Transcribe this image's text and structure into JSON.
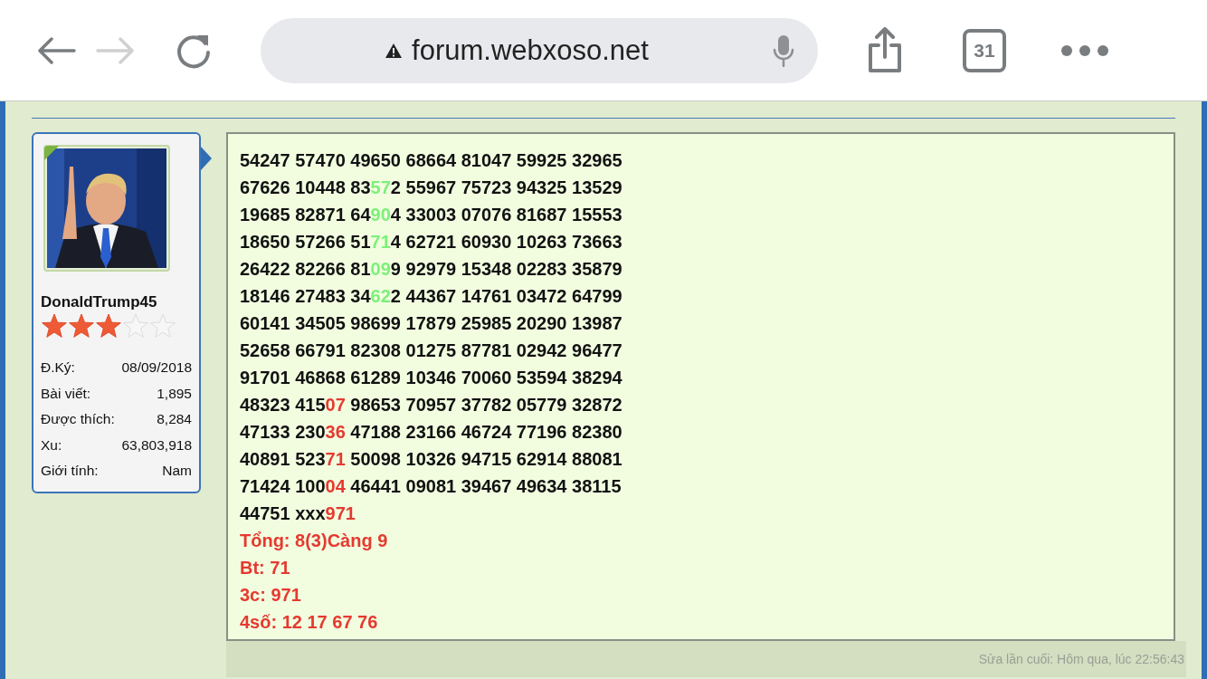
{
  "browser": {
    "url": "forum.webxoso.net",
    "tab_count": "31",
    "back_disabled": false,
    "forward_disabled": true
  },
  "user_card": {
    "username": "DonaldTrump45",
    "stars": 3,
    "stats": [
      {
        "label": "Đ.Ký:",
        "value": "08/09/2018"
      },
      {
        "label": "Bài viết:",
        "value": "1,895"
      },
      {
        "label": "Được thích:",
        "value": "8,284"
      },
      {
        "label": "Xu:",
        "value": "63,803,918"
      },
      {
        "label": "Giới tính:",
        "value": "Nam"
      }
    ]
  },
  "post": {
    "lines": [
      [
        {
          "text": "54247 57470 49650 68664 81047 59925 32965",
          "color": "#111111"
        }
      ],
      [
        {
          "text": "67626 10448 83",
          "color": "#111111"
        },
        {
          "text": "57",
          "color": "#7df07a"
        },
        {
          "text": "2 55967 75723 94325 13529",
          "color": "#111111"
        }
      ],
      [
        {
          "text": "19685 82871 64",
          "color": "#111111"
        },
        {
          "text": "90",
          "color": "#7df07a"
        },
        {
          "text": "4 33003 07076 81687 15553",
          "color": "#111111"
        }
      ],
      [
        {
          "text": "18650 57266 51",
          "color": "#111111"
        },
        {
          "text": "71",
          "color": "#7df07a"
        },
        {
          "text": "4 62721 60930 10263 73663",
          "color": "#111111"
        }
      ],
      [
        {
          "text": "26422 82266 81",
          "color": "#111111"
        },
        {
          "text": "09",
          "color": "#7df07a"
        },
        {
          "text": "9 92979 15348 02283 35879",
          "color": "#111111"
        }
      ],
      [
        {
          "text": "18146 27483 34",
          "color": "#111111"
        },
        {
          "text": "62",
          "color": "#7df07a"
        },
        {
          "text": "2 44367 14761 03472 64799",
          "color": "#111111"
        }
      ],
      [
        {
          "text": "60141 34505 98699 17879 25985 20290 13987",
          "color": "#111111"
        }
      ],
      [
        {
          "text": "52658 66791 82308 01275 87781 02942 96477",
          "color": "#111111"
        }
      ],
      [
        {
          "text": "91701 46868 61289 10346 70060 53594 38294",
          "color": "#111111"
        }
      ],
      [
        {
          "text": "48323 415",
          "color": "#111111"
        },
        {
          "text": "07",
          "color": "#e53a2f"
        },
        {
          "text": " 98653 70957 37782 05779 32872",
          "color": "#111111"
        }
      ],
      [
        {
          "text": "47133 230",
          "color": "#111111"
        },
        {
          "text": "36",
          "color": "#e53a2f"
        },
        {
          "text": " 47188 23166 46724 77196 82380",
          "color": "#111111"
        }
      ],
      [
        {
          "text": "40891 523",
          "color": "#111111"
        },
        {
          "text": "71",
          "color": "#e53a2f"
        },
        {
          "text": " 50098 10326 94715 62914 88081",
          "color": "#111111"
        }
      ],
      [
        {
          "text": "71424 100",
          "color": "#111111"
        },
        {
          "text": "04",
          "color": "#e53a2f"
        },
        {
          "text": " 46441 09081 39467 49634 38115",
          "color": "#111111"
        }
      ],
      [
        {
          "text": "44751 xxx",
          "color": "#111111"
        },
        {
          "text": "971",
          "color": "#e53a2f"
        }
      ],
      [
        {
          "text": "Tổng: 8(3)Càng 9",
          "color": "#e53a2f"
        }
      ],
      [
        {
          "text": "Bt: 71",
          "color": "#e53a2f"
        }
      ],
      [
        {
          "text": "3c: 971",
          "color": "#e53a2f"
        }
      ],
      [
        {
          "text": "4số: 12 17 67 76",
          "color": "#e53a2f"
        }
      ]
    ],
    "last_edit": "Sửa lần cuối: Hôm qua, lúc 22:56:43"
  }
}
